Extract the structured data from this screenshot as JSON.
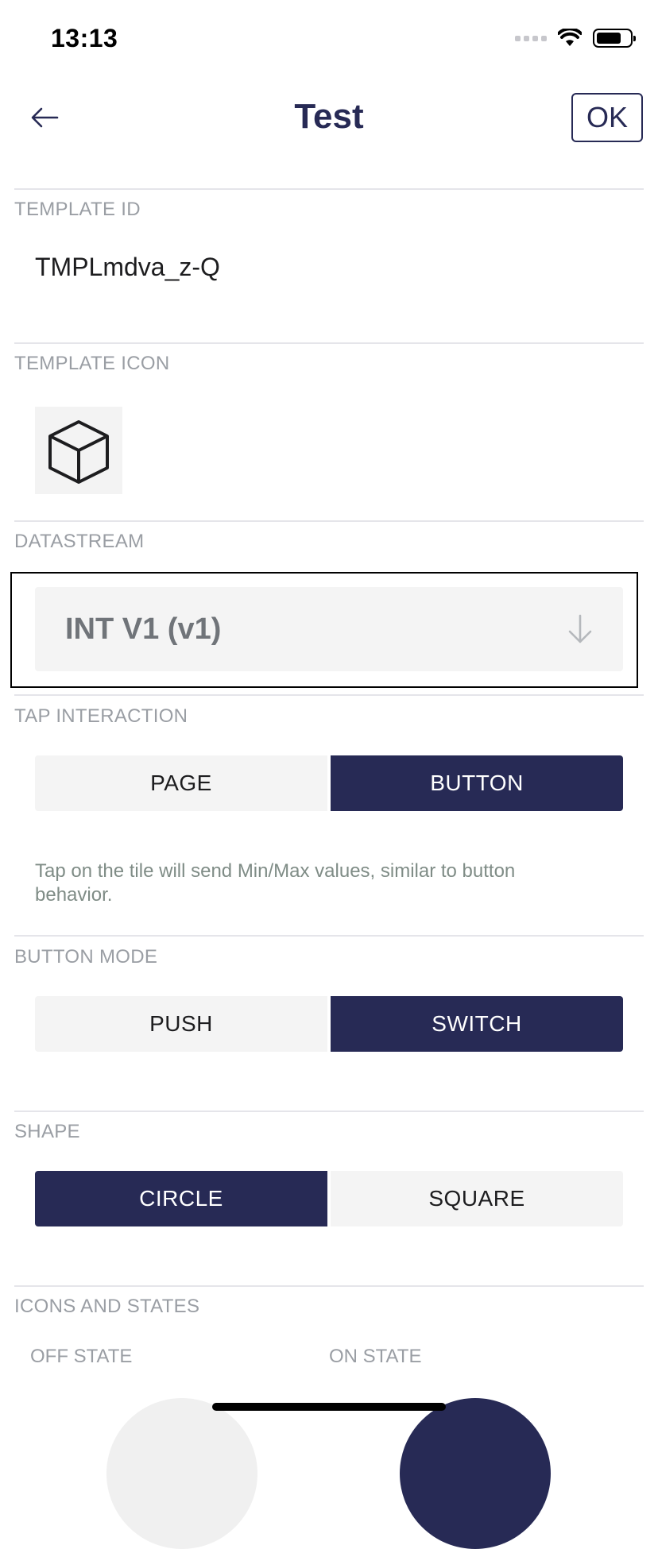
{
  "status_bar": {
    "time": "13:13"
  },
  "header": {
    "title": "Test",
    "ok_label": "OK"
  },
  "template_id": {
    "label": "TEMPLATE ID",
    "value": "TMPLmdva_z-Q"
  },
  "template_icon": {
    "label": "TEMPLATE ICON",
    "icon": "cube-icon"
  },
  "datastream": {
    "label": "DATASTREAM",
    "selected": "INT V1 (v1)"
  },
  "tap_interaction": {
    "label": "TAP INTERACTION",
    "options": [
      "PAGE",
      "BUTTON"
    ],
    "selected": "BUTTON",
    "hint": "Tap on the tile will send Min/Max values, similar to button behavior."
  },
  "button_mode": {
    "label": "BUTTON MODE",
    "options": [
      "PUSH",
      "SWITCH"
    ],
    "selected": "SWITCH"
  },
  "shape": {
    "label": "SHAPE",
    "options": [
      "CIRCLE",
      "SQUARE"
    ],
    "selected": "CIRCLE"
  },
  "icons_and_states": {
    "label": "ICONS AND STATES",
    "off_label": "OFF STATE",
    "on_label": "ON STATE"
  },
  "colors": {
    "accent": "#272a55",
    "segment_bg": "#f4f4f4",
    "label_gray": "#9a9ea4"
  }
}
